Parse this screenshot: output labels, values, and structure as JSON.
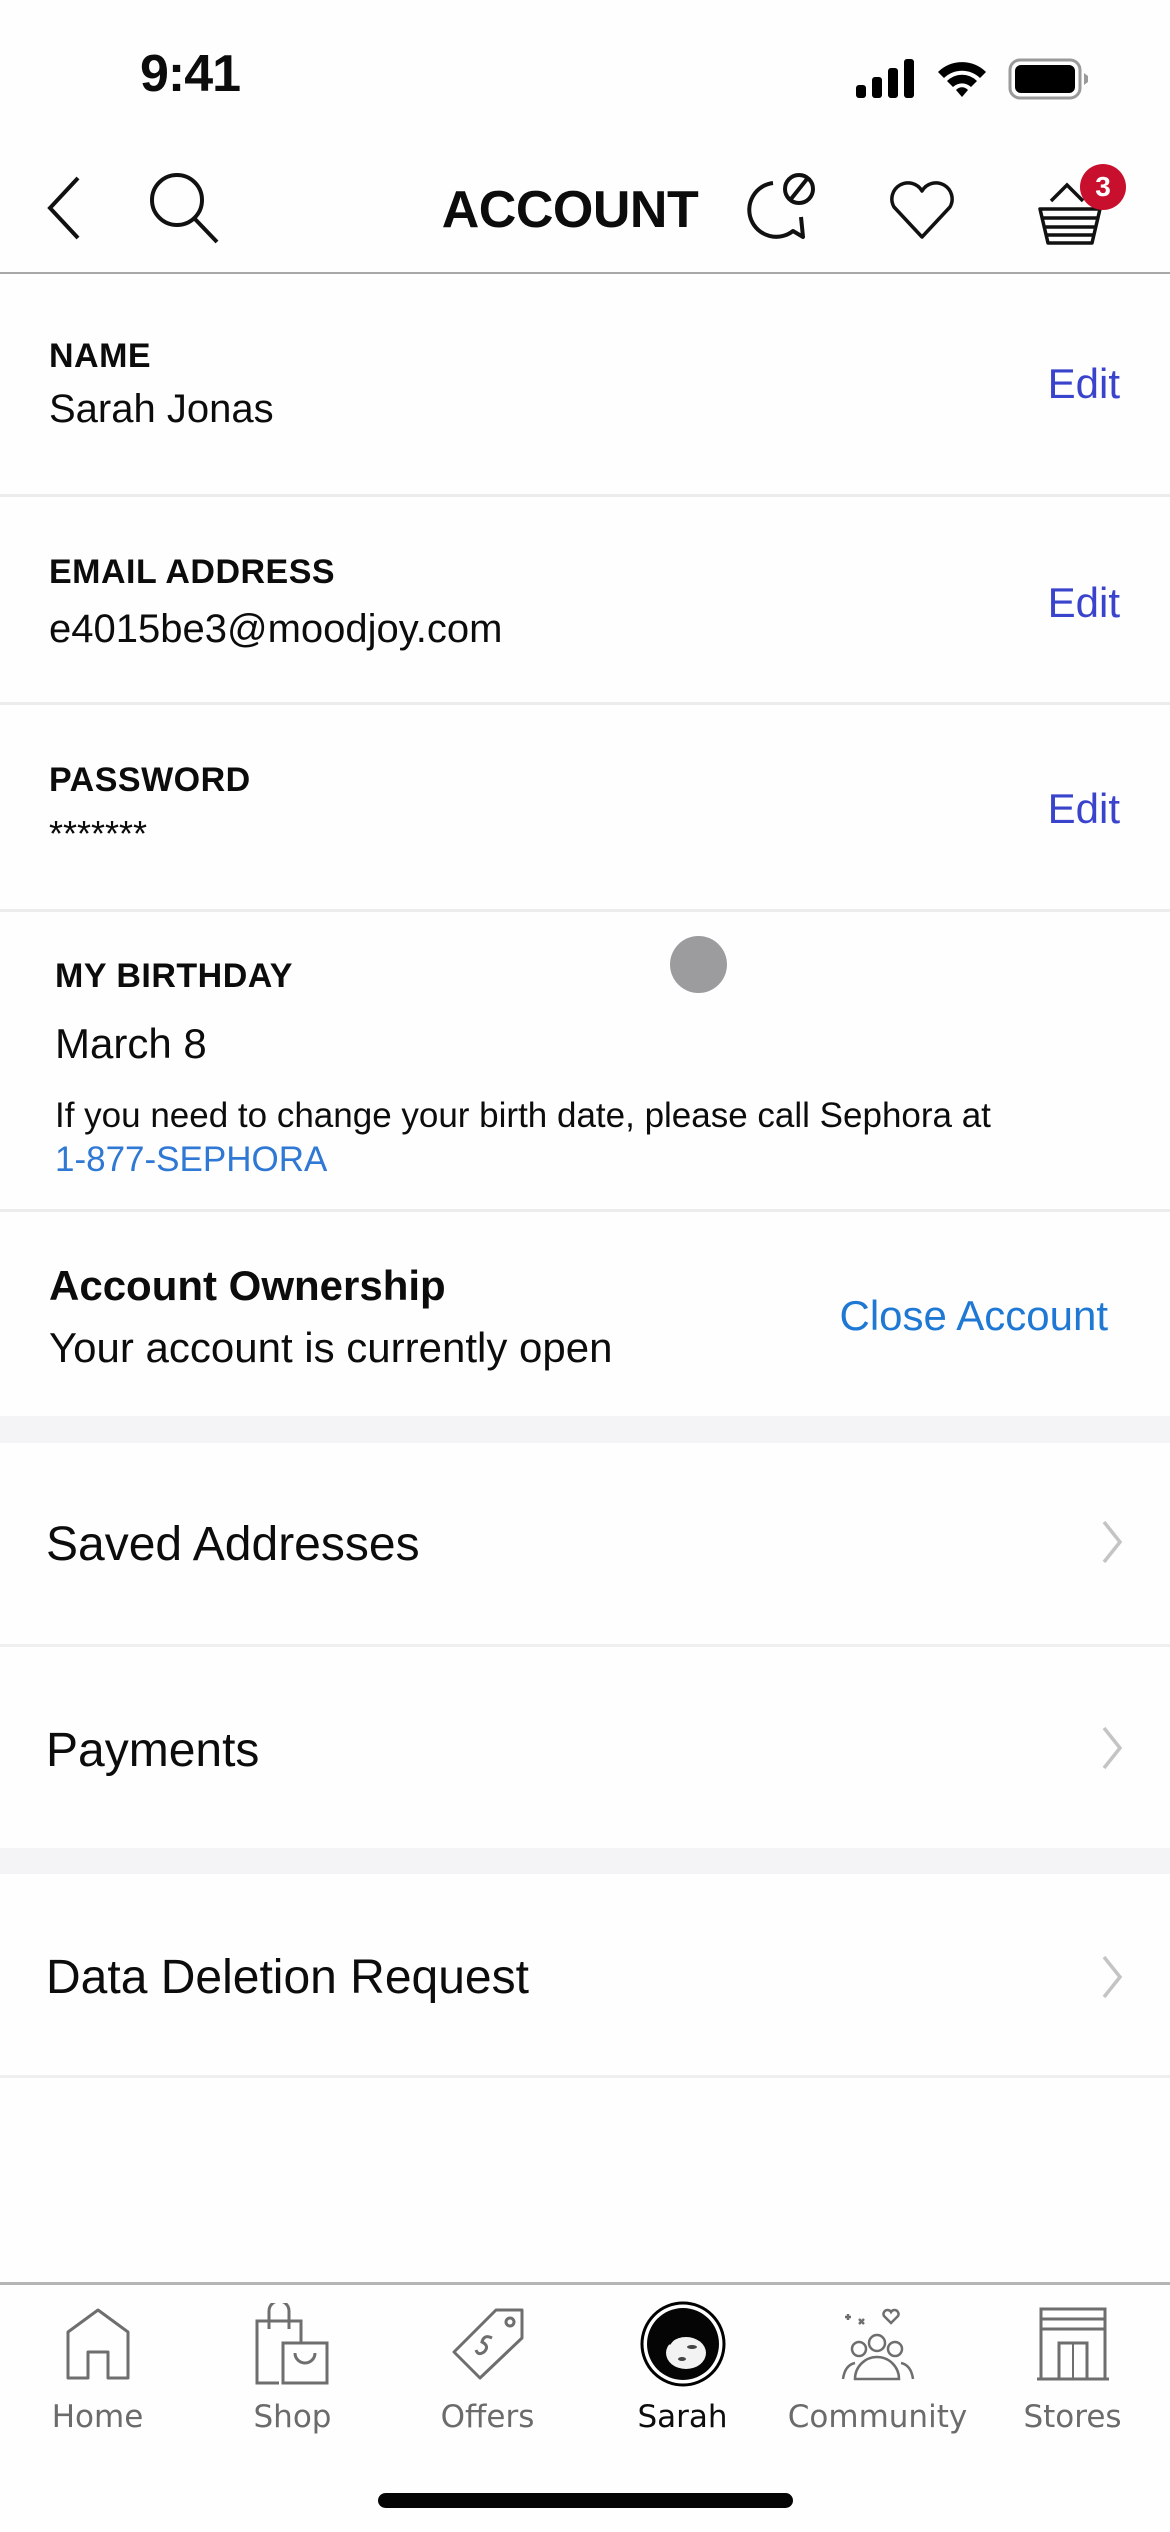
{
  "status_bar": {
    "time": "9:41"
  },
  "header": {
    "title": "ACCOUNT",
    "back_icon": "chevron-left-icon",
    "search_icon": "search-icon",
    "chat_icon": "chat-bubble-icon",
    "loves_icon": "heart-icon",
    "basket_icon": "basket-icon",
    "basket_count": "3",
    "badge_color": "#c8102e"
  },
  "fields": [
    {
      "label": "NAME",
      "value": "Sarah Jonas",
      "action": "Edit"
    },
    {
      "label": "EMAIL ADDRESS",
      "value": "e4015be3@moodjoy.com",
      "action": "Edit"
    },
    {
      "label": "PASSWORD",
      "value": "*******",
      "action": "Edit"
    }
  ],
  "birthday": {
    "label": "MY BIRTHDAY",
    "value": "March 8",
    "info": "If you need to change your birth date, please call Sephora at",
    "phone": "1-877-SEPHORA"
  },
  "ownership": {
    "title": "Account Ownership",
    "status": "Your account is currently open",
    "action": "Close Account"
  },
  "nav_rows": [
    {
      "label": "Saved Addresses"
    },
    {
      "label": "Payments"
    },
    {
      "label": "Data Deletion Request"
    }
  ],
  "colors": {
    "edit_link": "#3a43cc",
    "close_link": "#1e78d4",
    "phone_link": "#2f78d4",
    "section_gap": "#f4f3f5"
  },
  "tab_bar": {
    "tabs": [
      {
        "label": "Home",
        "icon": "home-icon",
        "active": false
      },
      {
        "label": "Shop",
        "icon": "shopping-bag-icon",
        "active": false
      },
      {
        "label": "Offers",
        "icon": "price-tag-icon",
        "active": false
      },
      {
        "label": "Sarah",
        "icon": "avatar",
        "active": true
      },
      {
        "label": "Community",
        "icon": "community-icon",
        "active": false
      },
      {
        "label": "Stores",
        "icon": "store-icon",
        "active": false
      }
    ]
  }
}
